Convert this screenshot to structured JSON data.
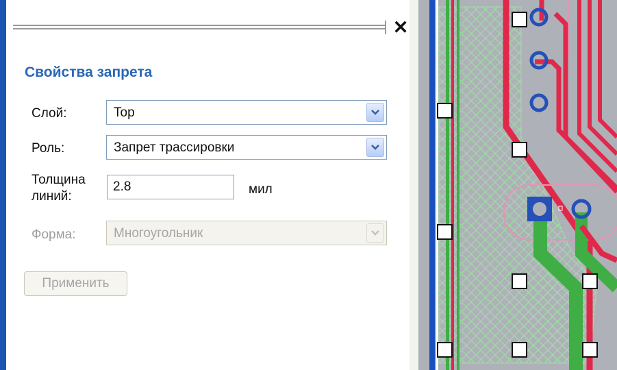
{
  "panel": {
    "close_icon": "✕",
    "section_title": "Свойства запрета",
    "layer": {
      "label": "Слой:",
      "value": "Top"
    },
    "role": {
      "label": "Роль:",
      "value": "Запрет трассировки"
    },
    "thickness": {
      "label_line1": "Толщина",
      "label_line2": "линий:",
      "value": "2.8",
      "unit": "мил"
    },
    "shape": {
      "label": "Форма:",
      "value": "Многоугольник",
      "disabled": true
    },
    "apply_label": "Применить"
  },
  "canvas": {
    "icon": "pcb-layout-canvas",
    "colors": {
      "board": "#aeb1b7",
      "track_red": "#e0284b",
      "track_green": "#3fae45",
      "blue_edge": "#1a4fbf",
      "pad_blue": "#2450b8",
      "pink_outline": "#ee8fb5",
      "hatch": "#9fe0a6"
    }
  }
}
